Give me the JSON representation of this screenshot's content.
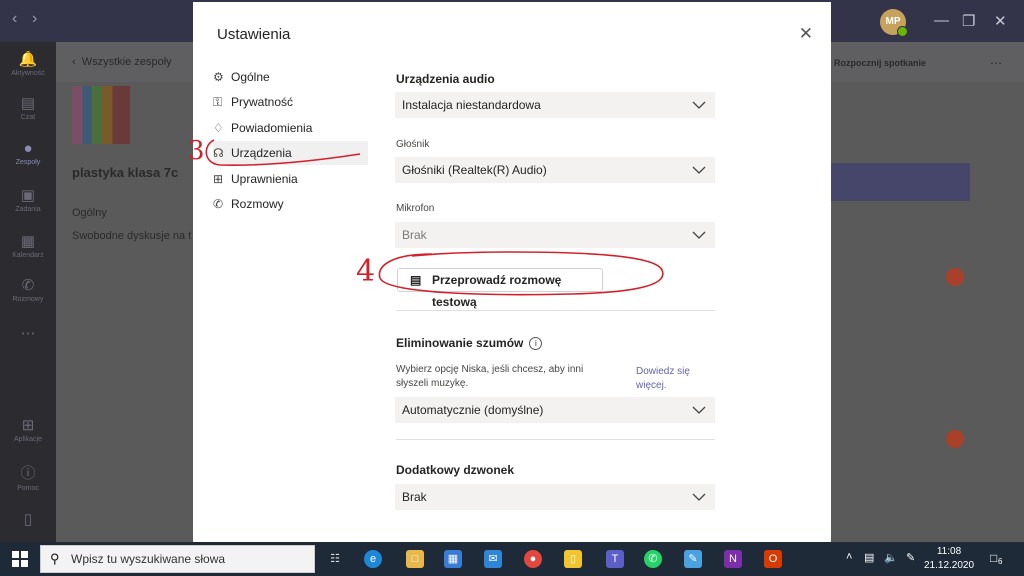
{
  "background": {
    "back_link": "Wszystkie zespoły",
    "team_name": "plastyka klasa 7c",
    "channel": "Ogólny",
    "channel_desc": "Swobodne dyskusje na t",
    "meet_button": "Rozpocznij spotkanie",
    "avatar_initials": "MP",
    "rail": [
      {
        "label": "Aktywność",
        "icon": "bell-icon"
      },
      {
        "label": "Czat",
        "icon": "chat-icon"
      },
      {
        "label": "Zespoły",
        "icon": "teams-icon"
      },
      {
        "label": "Zadania",
        "icon": "assignments-icon"
      },
      {
        "label": "Kalendarz",
        "icon": "calendar-icon"
      },
      {
        "label": "Rozmowy",
        "icon": "phone-icon"
      },
      {
        "label": "Aplikacje",
        "icon": "apps-icon"
      },
      {
        "label": "Pomoc",
        "icon": "help-icon"
      }
    ]
  },
  "dialog": {
    "title": "Ustawienia",
    "menu": [
      {
        "label": "Ogólne",
        "icon": "gear-icon"
      },
      {
        "label": "Prywatność",
        "icon": "lock-icon"
      },
      {
        "label": "Powiadomienia",
        "icon": "bell-icon"
      },
      {
        "label": "Urządzenia",
        "icon": "headset-icon",
        "active": true
      },
      {
        "label": "Uprawnienia",
        "icon": "permissions-icon"
      },
      {
        "label": "Rozmowy",
        "icon": "phone-icon"
      }
    ],
    "audio": {
      "title": "Urządzenia audio",
      "device": "Instalacja niestandardowa",
      "speaker_label": "Głośnik",
      "speaker": "Głośniki (Realtek(R) Audio)",
      "mic_label": "Mikrofon",
      "mic": "Brak",
      "test_button": "Przeprowadź rozmowę testową"
    },
    "noise": {
      "title": "Eliminowanie szumów",
      "desc": "Wybierz opcję Niska, jeśli chcesz, aby inni słyszeli muzykę.",
      "link": "Dowiedz się więcej.",
      "value": "Automatycznie (domyślne)"
    },
    "ring": {
      "title": "Dodatkowy dzwonek",
      "value": "Brak"
    }
  },
  "annotations": {
    "step3": "3",
    "step4": "4"
  },
  "taskbar": {
    "search_placeholder": "Wpisz tu wyszukiwane słowa",
    "time": "11:08",
    "date": "21.12.2020",
    "notifications": "6"
  },
  "colors": {
    "accent": "#6264a7",
    "annotation": "#d3202a"
  }
}
